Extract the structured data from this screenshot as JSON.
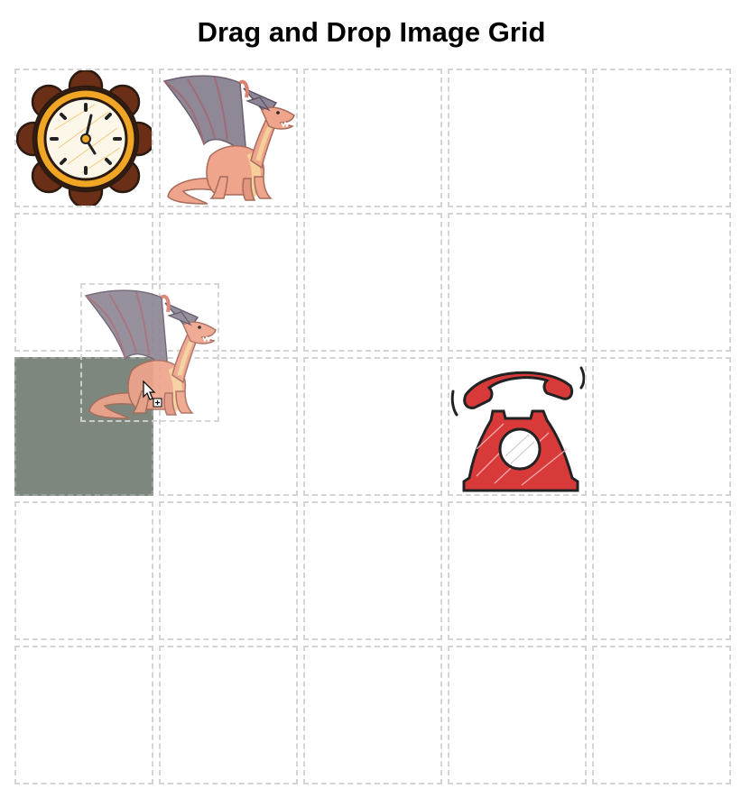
{
  "page": {
    "title": "Drag and Drop Image Grid"
  },
  "grid": {
    "rows": 5,
    "columns": 5,
    "items": [
      {
        "row": 0,
        "col": 0,
        "image": "clock",
        "icon": "clock-icon"
      },
      {
        "row": 0,
        "col": 1,
        "image": "dragon",
        "icon": "dragon-icon"
      },
      {
        "row": 2,
        "col": 3,
        "image": "telephone",
        "icon": "telephone-icon"
      }
    ],
    "drop_target": {
      "row": 2,
      "col": 0,
      "color": "#7e877d"
    },
    "dragging": {
      "image": "dragon",
      "icon": "dragon-icon"
    }
  },
  "colors": {
    "cell_border": "#d4d4d4",
    "drop_highlight": "#7e877d"
  }
}
